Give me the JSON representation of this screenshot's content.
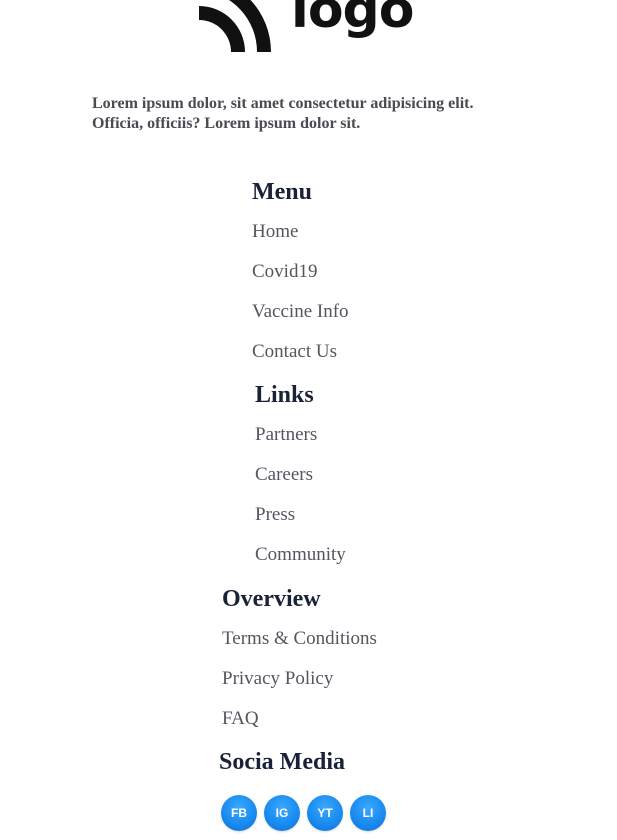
{
  "logo": {
    "text": "logo"
  },
  "intro": {
    "text": "Lorem ipsum dolor, sit amet consectetur adipisicing elit. Officia, officiis? Lorem ipsum dolor sit."
  },
  "menu": {
    "heading": "Menu",
    "items": [
      "Home",
      "Covid19",
      "Vaccine Info",
      "Contact Us"
    ]
  },
  "links": {
    "heading": "Links",
    "items": [
      "Partners",
      "Careers",
      "Press",
      "Community"
    ]
  },
  "overview": {
    "heading": "Overview",
    "items": [
      "Terms & Conditions",
      "Privacy Policy",
      "FAQ"
    ]
  },
  "social": {
    "heading": "Socia Media",
    "buttons": [
      "FB",
      "IG",
      "YT",
      "LI"
    ]
  },
  "colors": {
    "heading": "#1a2238",
    "link": "#555560",
    "intro": "#4a4a52",
    "social_button": "#1a8cf0"
  }
}
